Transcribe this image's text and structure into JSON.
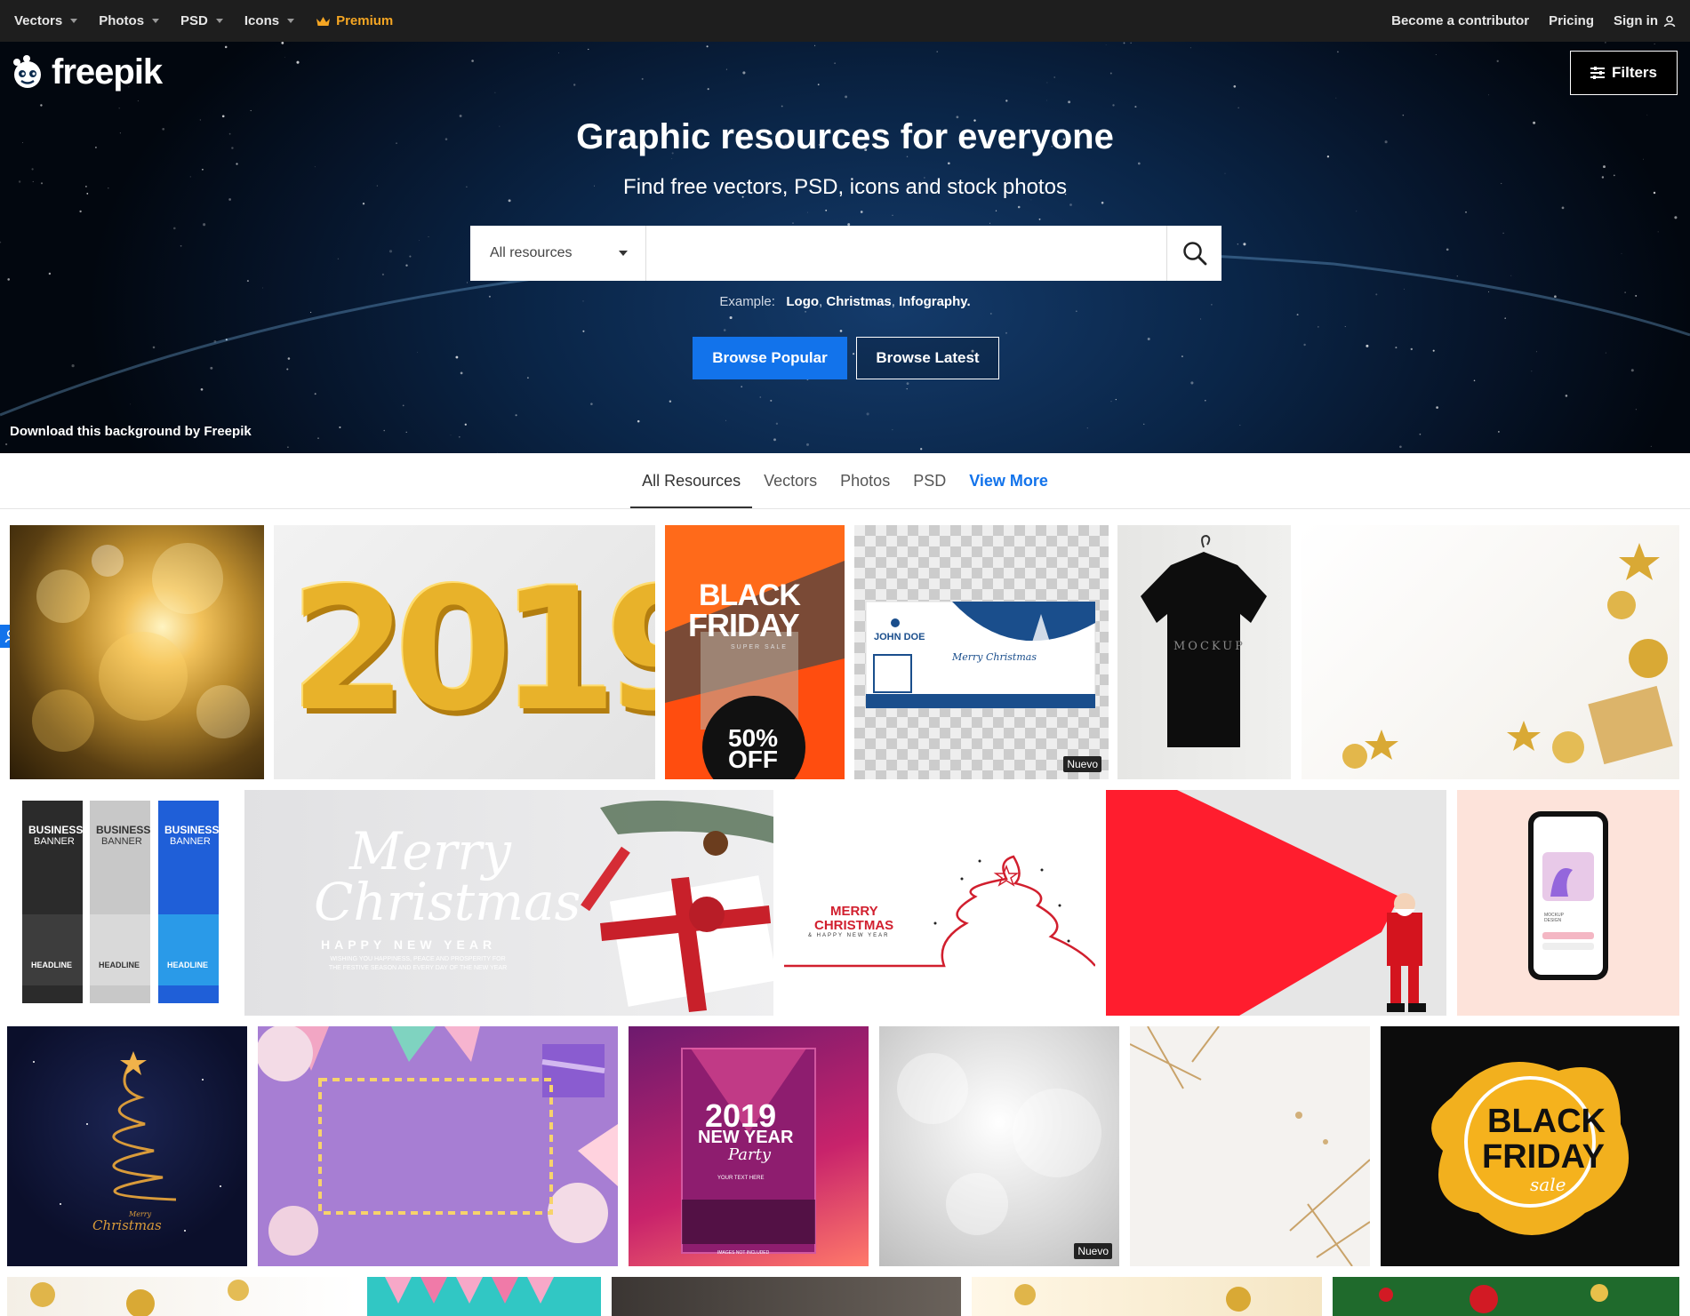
{
  "topnav": {
    "left": [
      {
        "label": "Vectors",
        "caret": true
      },
      {
        "label": "Photos",
        "caret": true
      },
      {
        "label": "PSD",
        "caret": true
      },
      {
        "label": "Icons",
        "caret": true
      }
    ],
    "premium": "Premium",
    "right": {
      "contributor": "Become a contributor",
      "pricing": "Pricing",
      "signin": "Sign in"
    }
  },
  "hero": {
    "logo": "freepik",
    "filters": "Filters",
    "title": "Graphic resources for everyone",
    "subtitle": "Find free vectors, PSD, icons and stock photos",
    "search": {
      "select": "All resources",
      "placeholder": ""
    },
    "example": {
      "label": "Example:",
      "items": [
        "Logo",
        "Christmas",
        "Infography."
      ]
    },
    "browse_popular": "Browse Popular",
    "browse_latest": "Browse Latest",
    "credit": "Download this background by Freepik"
  },
  "tabs": [
    "All Resources",
    "Vectors",
    "Photos",
    "PSD",
    "View More"
  ],
  "tiles": {
    "r1": [
      "Gold bokeh",
      "2019",
      "BLACK FRIDAY 50% OFF",
      "JOHN DOE Merry Christmas card",
      "MOCKUP",
      "Gold christmas decorations"
    ],
    "bf1_title1": "BLACK",
    "bf1_title2": "FRIDAY",
    "bf1_super": "SUPER SALE",
    "bf1_pct": "50%",
    "bf1_off": "OFF",
    "card_name": "JOHN DOE",
    "card_merry": "Merry Christmas",
    "mockup": "MOCKUP",
    "bn": [
      "BUSINESS",
      "BANNER",
      "HEADLINE"
    ],
    "merry": "Merry",
    "christmas": "Christmas",
    "hny": "HAPPY NEW YEAR",
    "hny_small": "WISHING YOU HAPPINESS, PEACE AND PROSPERITY FOR THE FESTIVE SEASON AND EVERY DAY OF THE NEW YEAR",
    "mc_red1": "MERRY",
    "mc_red2": "CHRISTMAS",
    "mc_red3": "& HAPPY NEW YEAR",
    "phone_label": "MOCKUP DESIGN",
    "tree_merry": "Merry",
    "tree_christmas": "Christmas",
    "ny_year": "2019",
    "ny_title": "NEW YEAR",
    "ny_party": "Party",
    "ny_your": "YOUR TEXT HERE",
    "ny_footer": "IMAGES NOT INCLUDED",
    "bf2_1": "BLACK",
    "bf2_2": "FRIDAY",
    "bf2_3": "sale",
    "nuevo": "Nuevo"
  }
}
